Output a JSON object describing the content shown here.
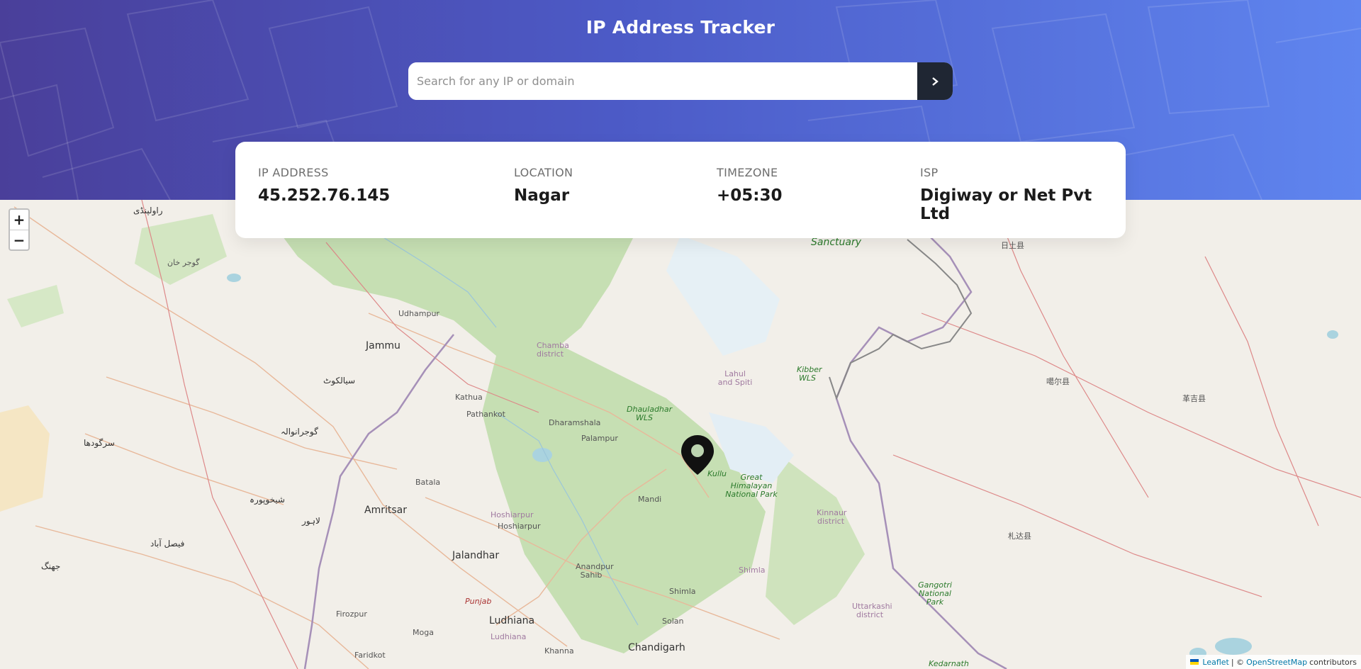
{
  "app": {
    "title": "IP Address Tracker"
  },
  "search": {
    "placeholder": "Search for any IP or domain",
    "value": ""
  },
  "info": {
    "ip_label": "IP ADDRESS",
    "ip_value": "45.252.76.145",
    "location_label": "LOCATION",
    "location_value": "Nagar",
    "timezone_label": "TIMEZONE",
    "timezone_value": "+05:30",
    "isp_label": "ISP",
    "isp_value": "Digiway or Net Pvt Ltd"
  },
  "map": {
    "zoom_in": "+",
    "zoom_out": "−",
    "attribution": {
      "leaflet": "Leaflet",
      "separator": "| ©",
      "osm": "OpenStreetMap",
      "suffix": "contributors"
    },
    "labels": {
      "rawalpindi": "راولپنڈی",
      "gujar_khan": "گوجر خان",
      "udhampur": "Udhampur",
      "jammu": "Jammu",
      "chamba": "Chamba district",
      "sialkot": "سیالکوٹ",
      "kathua": "Kathua",
      "pathankot": "Pathankot",
      "dharamshala": "Dharamshala",
      "dhauladhar": "Dhauladhar WLS",
      "lahul": "Lahul and Spiti",
      "kibber": "Kibber WLS",
      "sanctuary": "Sanctuary",
      "rutog": "日土县",
      "gar": "噶尔县",
      "gegye": "革吉县",
      "zanda": "札达县",
      "sargodha": "سرگودھا",
      "gujranwala": "گوجرانوالہ",
      "palampur": "Palampur",
      "kullu": "Kullu",
      "great_himalayan": "Great Himalayan National Park",
      "batala": "Batala",
      "sheikhupura": "شیخوپورہ",
      "amritsar": "Amritsar",
      "mandi": "Mandi",
      "lahore": "لاہور",
      "hoshiarpur_d": "Hoshiarpur",
      "hoshiarpur": "Hoshiarpur",
      "kinnaur": "Kinnaur district",
      "faisalabad": "فیصل آباد",
      "jalandhar": "Jalandhar",
      "jhang": "جھنگ",
      "anandpur": "Anandpur Sahib",
      "shimla_d": "Shimla",
      "shimla": "Shimla",
      "gangotri": "Gangotri National Park",
      "punjab": "Punjab",
      "uttarkashi": "Uttarkashi district",
      "ludhiana": "Ludhiana",
      "ludhiana_d": "Ludhiana",
      "solan": "Solan",
      "firozpur": "Firozpur",
      "moga": "Moga",
      "chandigarh": "Chandigarh",
      "khanna": "Khanna",
      "faridkot": "Faridkot",
      "kedarnath": "Kedarnath"
    }
  },
  "colors": {
    "header_start": "#4a3f9a",
    "header_end": "#5f85ef",
    "search_button": "#1f2633",
    "marker": "#111111"
  }
}
